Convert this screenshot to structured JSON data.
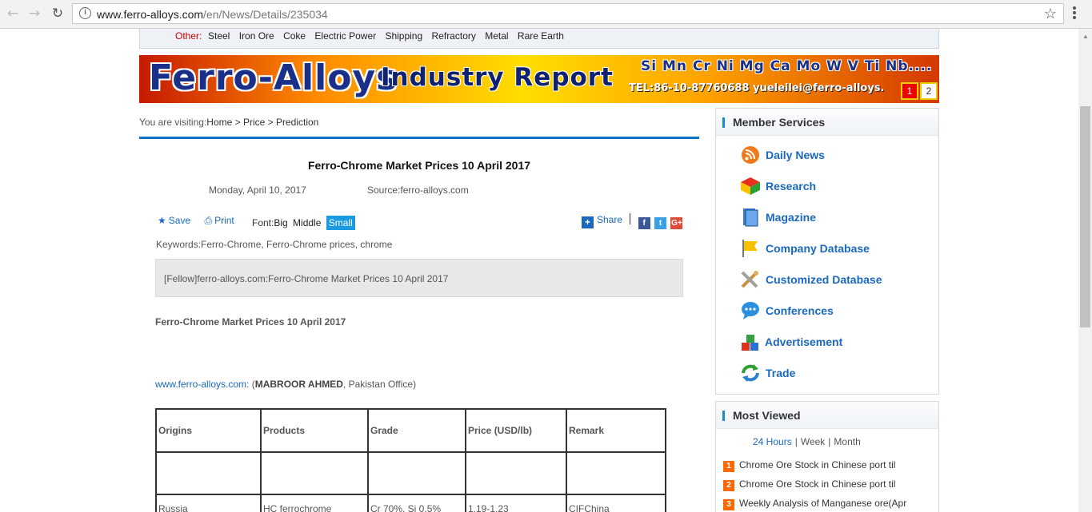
{
  "browser": {
    "url_host": "www.ferro-alloys.com",
    "url_path": "/en/News/Details/235034"
  },
  "categories": {
    "label": "Other:",
    "items": [
      "Steel",
      "Iron Ore",
      "Coke",
      "Electric Power",
      "Shipping",
      "Refractory",
      "Metal",
      "Rare Earth"
    ]
  },
  "banner": {
    "title_main": "Ferro-Alloys",
    "title_sub": "Industry Report",
    "elements": "Si Mn Cr Ni Mg Ca Mo W V Ti Nb....",
    "contact": "TEL:86-10-87760688 yueleilei@ferro-alloys.",
    "pages": [
      "1",
      "2"
    ]
  },
  "breadcrumb": {
    "prefix": "You are visiting:",
    "path": "Home > Price > Prediction"
  },
  "article": {
    "title": "Ferro-Chrome Market Prices 10 April 2017",
    "date": "Monday, April 10, 2017",
    "source": "Source:ferro-alloys.com",
    "save_label": "Save",
    "print_label": "Print",
    "font_label": "Font:",
    "font_big": "Big",
    "font_middle": "Middle",
    "font_small": "Small",
    "share_label": "Share",
    "keywords": "Keywords:Ferro-Chrome, Ferro-Chrome prices, chrome",
    "summary": "[Fellow]ferro-alloys.com:Ferro-Chrome Market Prices 10 April 2017",
    "body_title": "Ferro-Chrome Market Prices 10 April 2017",
    "byline_link": "www.ferro-alloys.com",
    "byline_sep": ": (",
    "byline_author": "MABROOR AHMED",
    "byline_office": ", Pakistan Office)"
  },
  "price_table": {
    "headers": [
      "Origins",
      "Products",
      "Grade",
      "Price (USD/lb)",
      "Remark"
    ],
    "rows": [
      [
        "",
        "",
        "",
        "",
        ""
      ],
      [
        "Russia",
        "HC ferrochrome",
        "Cr 70%, Si 0.5%",
        "1.19-1.23",
        "CIFChina"
      ]
    ]
  },
  "member_services": {
    "title": "Member Services",
    "items": [
      {
        "label": "Daily News",
        "icon": "rss-icon"
      },
      {
        "label": "Research",
        "icon": "research-cube-icon"
      },
      {
        "label": "Magazine",
        "icon": "magazine-icon"
      },
      {
        "label": "Company Database",
        "icon": "flag-icon"
      },
      {
        "label": "Customized Database",
        "icon": "tools-icon"
      },
      {
        "label": "Conferences",
        "icon": "chat-bubble-icon"
      },
      {
        "label": "Advertisement",
        "icon": "blocks-icon"
      },
      {
        "label": "Trade",
        "icon": "refresh-icon"
      }
    ]
  },
  "most_viewed": {
    "title": "Most Viewed",
    "tabs": [
      "24 Hours",
      "Week",
      "Month"
    ],
    "items": [
      {
        "rank": "1",
        "text": "Chrome Ore Stock in Chinese port til"
      },
      {
        "rank": "2",
        "text": "Chrome Ore Stock in Chinese port til"
      },
      {
        "rank": "3",
        "text": "Weekly Analysis of Manganese ore(Apr"
      }
    ]
  },
  "colors": {
    "accent_blue": "#1a68c0",
    "rule_blue": "#0d72c8",
    "rank_orange": "#ff6a00"
  }
}
